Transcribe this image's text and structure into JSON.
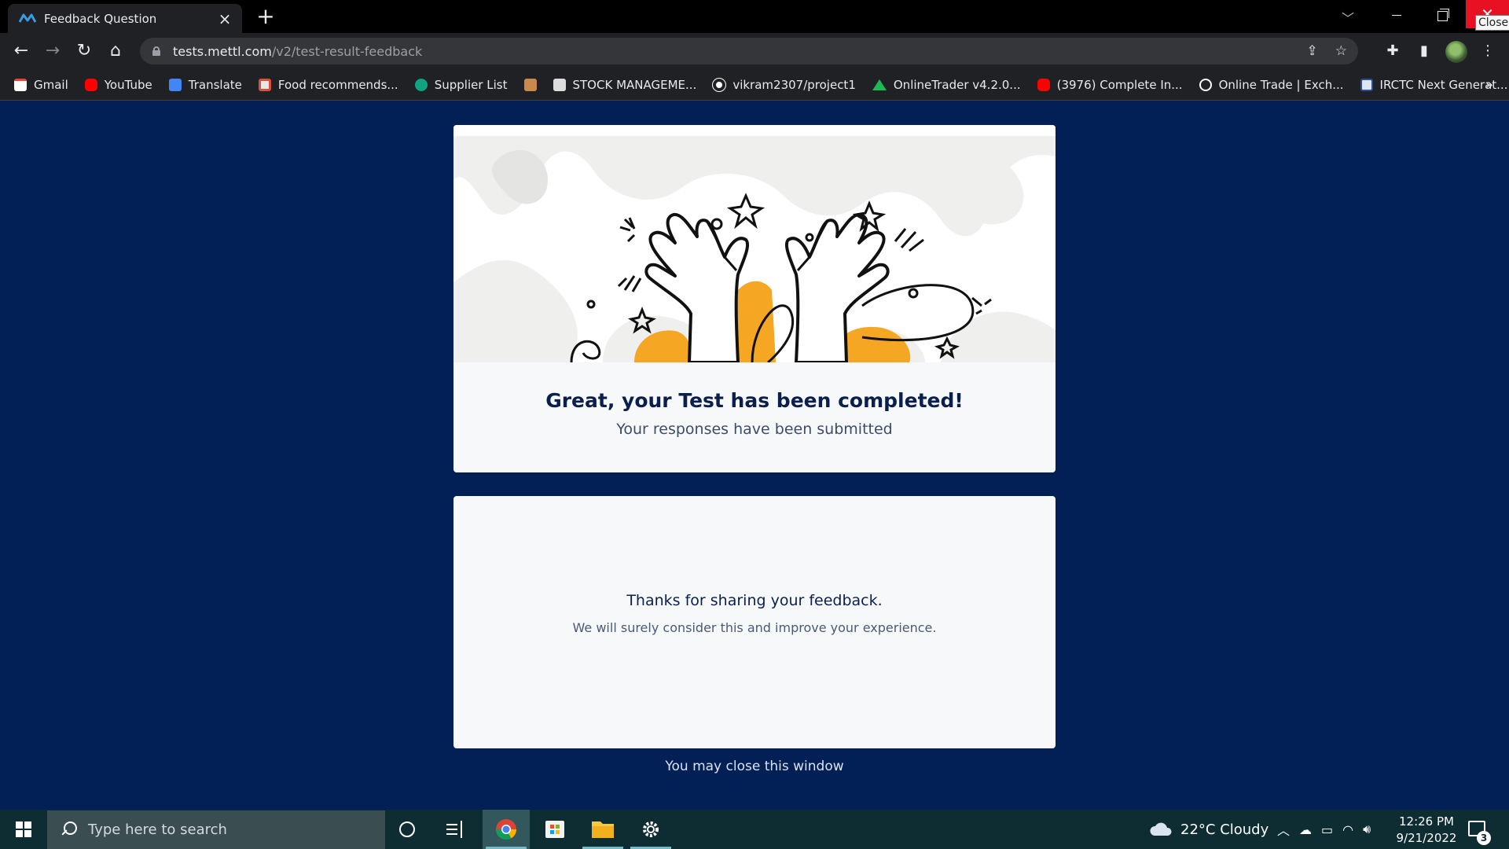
{
  "browser": {
    "tab_title": "Feedback Question",
    "tab_close_icon": "×",
    "new_tab_icon": "+",
    "url_host": "tests.mettl.com",
    "url_path": "/v2/test-result-feedback",
    "close_tooltip": "Close",
    "bookmarks": [
      {
        "label": "Gmail",
        "icon": "gmail-icon",
        "color": "#ea4335"
      },
      {
        "label": "YouTube",
        "icon": "youtube-icon",
        "color": "#ff0000"
      },
      {
        "label": "Translate",
        "icon": "translate-icon",
        "color": "#4285f4"
      },
      {
        "label": "Food recommends...",
        "icon": "food-icon",
        "color": "#e8e8e8"
      },
      {
        "label": "Supplier List",
        "icon": "supplier-icon",
        "color": "#0fa47f"
      },
      {
        "label": "",
        "icon": "bookmark-image-icon",
        "color": "#c98a4b"
      },
      {
        "label": "STOCK MANAGEME...",
        "icon": "stock-icon",
        "color": "#dddddd"
      },
      {
        "label": "vikram2307/project1",
        "icon": "github-icon",
        "color": "#ffffff"
      },
      {
        "label": "OnlineTrader v4.2.0...",
        "icon": "trader-icon",
        "color": "#1db954"
      },
      {
        "label": "(3976) Complete In...",
        "icon": "youtube-icon",
        "color": "#ff0000"
      },
      {
        "label": "Online Trade | Exch...",
        "icon": "globe-icon",
        "color": "#ffffff"
      },
      {
        "label": "IRCTC Next Generat...",
        "icon": "irctc-icon",
        "color": "#dfe6f3"
      }
    ],
    "bookmarks_more": "»"
  },
  "page": {
    "completed_title": "Great, your Test has been completed!",
    "completed_subtitle": "Your responses have been submitted",
    "thanks_title": "Thanks for sharing your feedback.",
    "thanks_subtitle": "We will surely consider this and improve your experience.",
    "close_note": "You may close this window",
    "accent_color": "#f5a623",
    "background_color": "#021f56"
  },
  "taskbar": {
    "search_placeholder": "Type here to search",
    "weather": "22°C  Cloudy",
    "time": "12:26 PM",
    "date": "9/21/2022",
    "notification_count": "3"
  }
}
